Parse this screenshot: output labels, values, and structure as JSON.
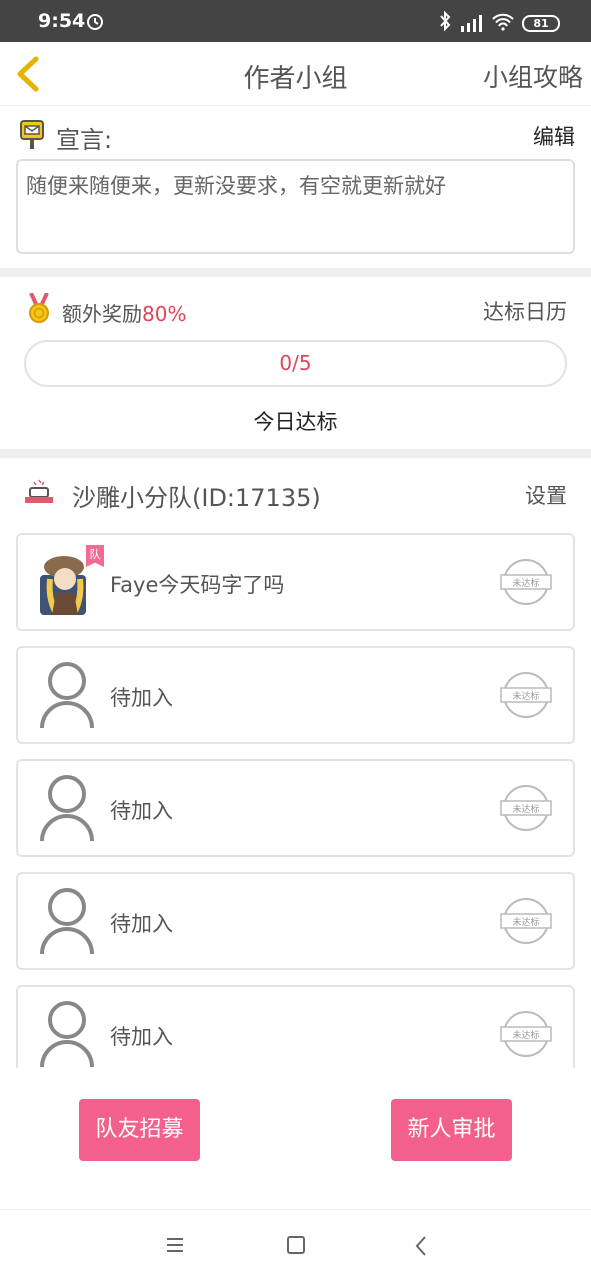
{
  "status_bar": {
    "time": "9:54",
    "battery": "81"
  },
  "header": {
    "title": "作者小组",
    "right_link": "小组攻略"
  },
  "declaration": {
    "label": "宣言:",
    "edit": "编辑",
    "text": "随便来随便来，更新没要求，有空就更新就好"
  },
  "reward": {
    "label": "额外奖励",
    "percent": "80%",
    "calendar": "达标日历",
    "progress": "0/5",
    "today": "今日达标"
  },
  "team": {
    "name": "沙雕小分队(ID:17135)",
    "settings": "设置",
    "leader_badge": "队",
    "stamp_text": "未达标",
    "members": [
      {
        "name": "Faye今天码字了吗"
      },
      {
        "name": "待加入"
      },
      {
        "name": "待加入"
      },
      {
        "name": "待加入"
      },
      {
        "name": "待加入"
      }
    ]
  },
  "buttons": {
    "recruit": "队友招募",
    "approve": "新人审批"
  },
  "colors": {
    "accent": "#f4608c",
    "highlight": "#e0455a",
    "back_arrow": "#e6b400"
  }
}
